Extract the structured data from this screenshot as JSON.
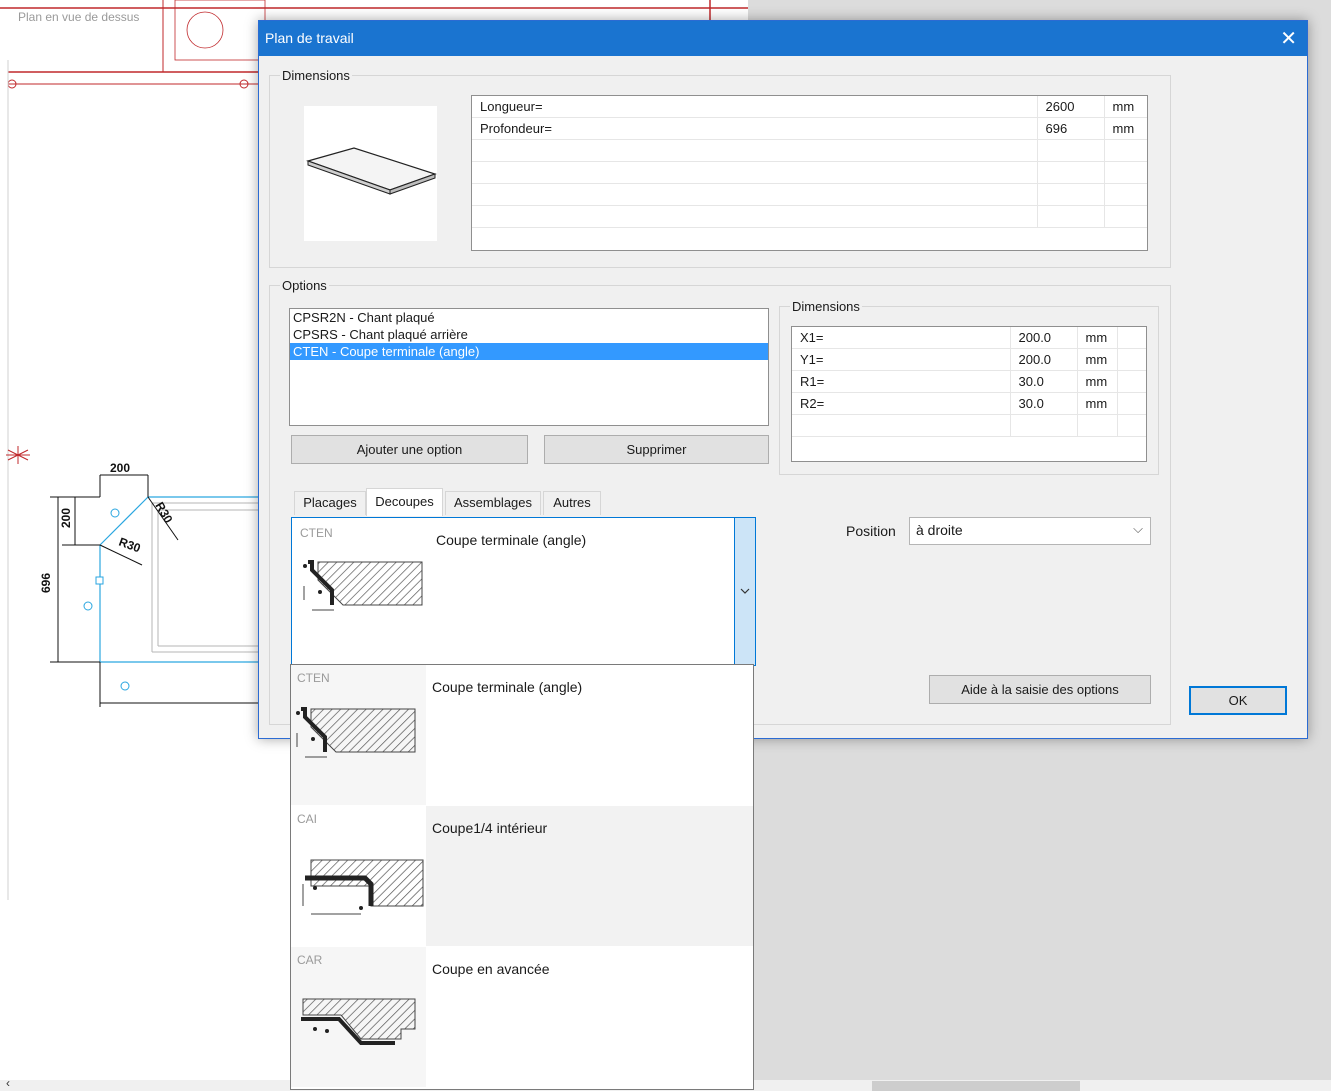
{
  "background": {
    "view_label": "Plan en vue de dessus",
    "dims": {
      "width_top": "200",
      "height_left": "200",
      "radius_1": "R30",
      "radius_2": "R30",
      "depth": "696"
    }
  },
  "dialog": {
    "title": "Plan de travail",
    "dimensions_group": {
      "legend": "Dimensions",
      "rows": [
        {
          "label": "Longueur=",
          "value": "2600",
          "unit": "mm"
        },
        {
          "label": "Profondeur=",
          "value": "696",
          "unit": "mm"
        }
      ]
    },
    "options_group": {
      "legend": "Options",
      "items": [
        {
          "label": "CPSR2N - Chant plaqué",
          "selected": false
        },
        {
          "label": "CPSRS - Chant plaqué arrière",
          "selected": false
        },
        {
          "label": "CTEN - Coupe terminale (angle)",
          "selected": true
        }
      ],
      "add_button": "Ajouter une option",
      "delete_button": "Supprimer"
    },
    "option_dims": {
      "legend": "Dimensions",
      "rows": [
        {
          "label": "X1=",
          "value": "200.0",
          "unit": "mm"
        },
        {
          "label": "Y1=",
          "value": "200.0",
          "unit": "mm"
        },
        {
          "label": "R1=",
          "value": "30.0",
          "unit": "mm"
        },
        {
          "label": "R2=",
          "value": "30.0",
          "unit": "mm"
        }
      ]
    },
    "tabs": [
      "Placages",
      "Decoupes",
      "Assemblages",
      "Autres"
    ],
    "active_tab": "Decoupes",
    "combo": {
      "code": "CTEN",
      "label": "Coupe terminale (angle)"
    },
    "position": {
      "label": "Position",
      "value": "à droite"
    },
    "help_button": "Aide à la saisie des options",
    "ok_button": "OK"
  },
  "dropdown": [
    {
      "code": "CTEN",
      "label": "Coupe terminale (angle)"
    },
    {
      "code": "CAI",
      "label": "Coupe1/4 intérieur"
    },
    {
      "code": "CAR",
      "label": "Coupe en avancée"
    }
  ],
  "colors": {
    "title_bar": "#1a74d0",
    "selection": "#3399ff",
    "cad_red": "#c0282b",
    "cad_cyan": "#2aa6e0"
  }
}
